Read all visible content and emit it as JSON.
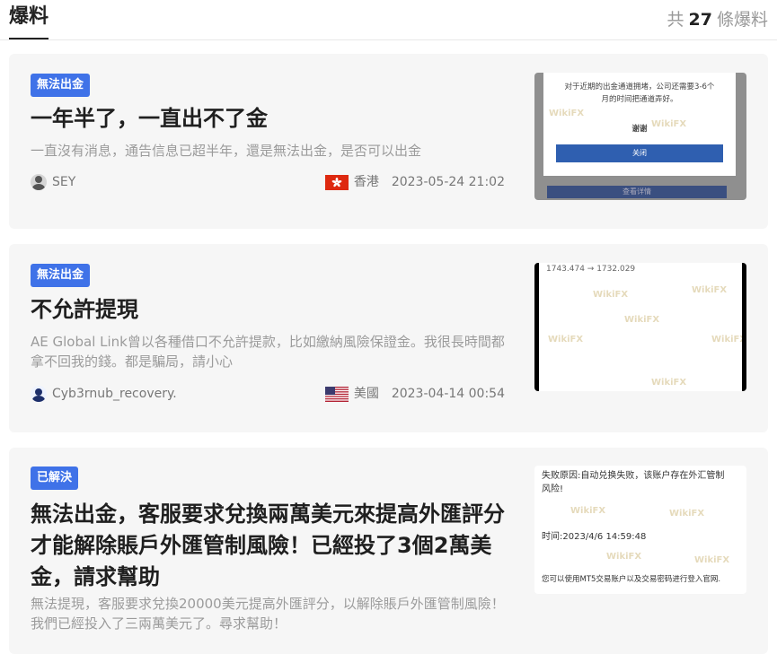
{
  "header": {
    "title": "爆料",
    "count_prefix": "共",
    "count": "27",
    "count_suffix": "條爆料"
  },
  "posts": [
    {
      "badge": "無法出金",
      "title": "一年半了，一直出不了金",
      "summary": "一直沒有消息，通告信息已超半年，還是無法出金，是否可以出金",
      "user": "SEY",
      "region": "香港",
      "date": "2023-05-24 21:02",
      "thumb_lines": [
        "对于近期的出金通道拥堵，公司还需要3-6个",
        "月的时间把通道弄好。",
        "谢谢",
        "关闭",
        "查看详情"
      ]
    },
    {
      "badge": "無法出金",
      "title": "不允許提現",
      "summary": "AE Global Link曾以各種借口不允許提款，比如繳納風險保證金。我很長時間都拿不回我的錢。都是騙局，請小心",
      "user": "Cyb3rnub_recovery.",
      "region": "美國",
      "date": "2023-04-14 00:54",
      "thumb_lines": [
        "1743.474 → 1732.029"
      ]
    },
    {
      "badge": "已解決",
      "title": "無法出金，客服要求兌換兩萬美元來提高外匯評分才能解除賬戶外匯管制風險！已經投了3個2萬美金，請求幫助",
      "summary": "無法提現，客服要求兌換20000美元提高外匯評分，以解除賬戶外匯管制風險！我們已經投入了三兩萬美元了。尋求幫助！",
      "thumb_lines": [
        "失败原因:自动兑换失败，该账户存在外汇管制",
        "风险!",
        "时间:2023/4/6 14:59:48",
        "您可以使用MT5交易账户以及交易密码进行登入官网."
      ]
    }
  ],
  "watermark": "WikiFX",
  "colors": {
    "badge": "#3f72e8",
    "card_bg": "#f6f6f6",
    "muted_text": "#9b9b9b"
  }
}
